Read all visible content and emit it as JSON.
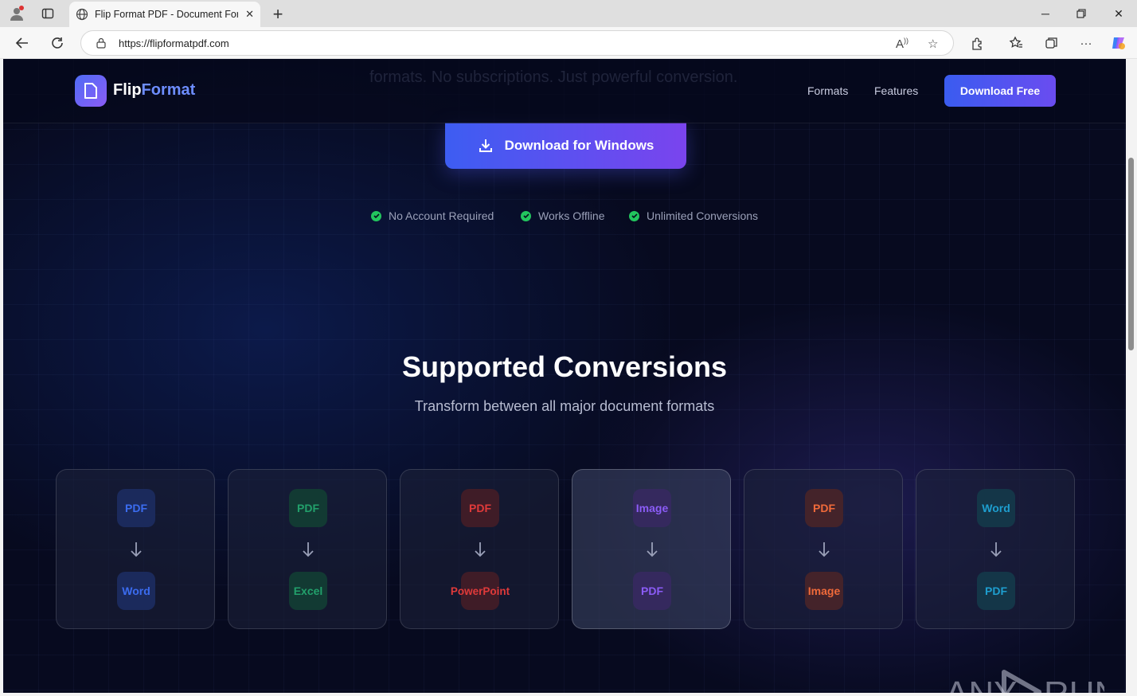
{
  "browser": {
    "tab_title": "Flip Format PDF - Document Form",
    "url": "https://flipformatpdf.com"
  },
  "header": {
    "ghost_text": "formats. No subscriptions. Just powerful conversion.",
    "logo_part1": "Flip",
    "logo_part2": "Format",
    "nav": [
      "Formats",
      "Features"
    ],
    "cta": "Download Free"
  },
  "hero": {
    "download_button": "Download for Windows",
    "badges": [
      "No Account Required",
      "Works Offline",
      "Unlimited Conversions"
    ]
  },
  "conversions": {
    "title": "Supported Conversions",
    "subtitle": "Transform between all major document formats",
    "cards": [
      {
        "from": "PDF",
        "to": "Word"
      },
      {
        "from": "PDF",
        "to": "Excel"
      },
      {
        "from": "PDF",
        "to": "PowerPoint"
      },
      {
        "from": "Image",
        "to": "PDF"
      },
      {
        "from": "PDF",
        "to": "Image"
      },
      {
        "from": "Word",
        "to": "PDF"
      }
    ]
  },
  "watermark": "ANY RUN",
  "colors": {
    "accent": "#3d5df2",
    "accent2": "#7a44ee",
    "check": "#22c55e",
    "blue": "#3b6cf0",
    "green": "#22a06b",
    "red": "#e03a3a",
    "purple": "#8b5cf6",
    "orange": "#f06a3a",
    "teal": "#1e9ecf"
  }
}
